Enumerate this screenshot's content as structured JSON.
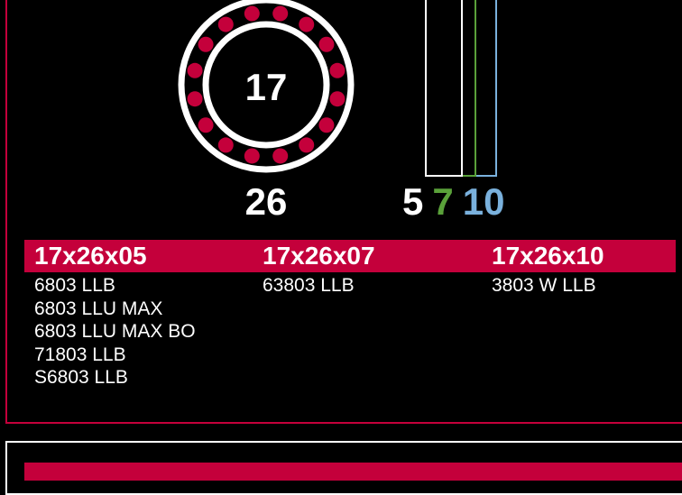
{
  "dimensions": {
    "inner_diameter": "17",
    "outer_diameter": "26",
    "widths": [
      "5",
      "7",
      "10"
    ]
  },
  "colors": {
    "accent_red": "#c4003b",
    "width_5": "#ffffff",
    "width_7": "#5aa13a",
    "width_10": "#7ab1dd",
    "background": "#000000"
  },
  "columns": [
    {
      "title": "17x26x05",
      "items": [
        "6803 LLB",
        "6803 LLU MAX",
        "6803 LLU MAX BO",
        "71803 LLB",
        "S6803 LLB"
      ]
    },
    {
      "title": "17x26x07",
      "items": [
        "63803 LLB"
      ]
    },
    {
      "title": "17x26x10",
      "items": [
        "3803 W LLB"
      ]
    }
  ]
}
